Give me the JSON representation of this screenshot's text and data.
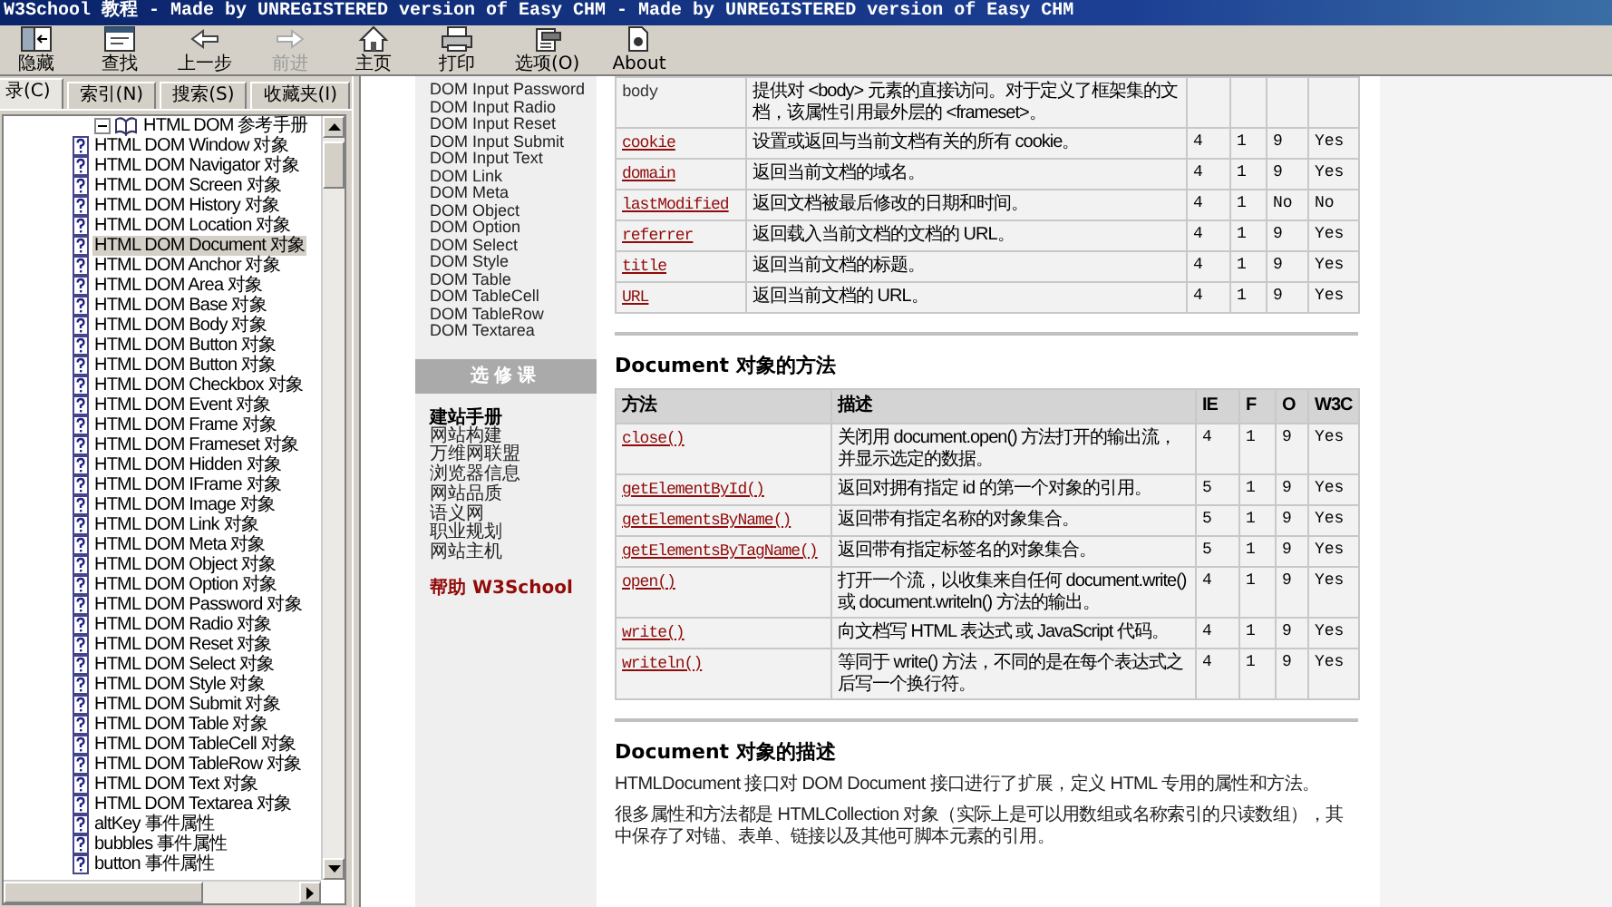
{
  "window": {
    "title": "W3School 教程 - Made by UNREGISTERED version of Easy CHM - Made by UNREGISTERED version of Easy CHM"
  },
  "toolbar": [
    {
      "kind": "hide",
      "label": "隐藏",
      "disabled": false
    },
    {
      "kind": "find",
      "label": "查找",
      "disabled": false
    },
    {
      "kind": "back",
      "label": "上一步",
      "disabled": false
    },
    {
      "kind": "forward",
      "label": "前进",
      "disabled": true
    },
    {
      "kind": "home",
      "label": "主页",
      "disabled": false
    },
    {
      "kind": "print",
      "label": "打印",
      "disabled": false
    },
    {
      "kind": "options",
      "label": "选项(O)",
      "disabled": false
    },
    {
      "kind": "about",
      "label": "About",
      "disabled": false
    }
  ],
  "nav_tabs": [
    {
      "label": "录(C)",
      "selected": true
    },
    {
      "label": "索引(N)",
      "selected": false
    },
    {
      "label": "搜索(S)",
      "selected": false
    },
    {
      "label": "收藏夹(I)",
      "selected": false
    }
  ],
  "tree": {
    "label": "HTML DOM 参考手册",
    "expanded": true,
    "children": [
      {
        "label": "HTML DOM Window 对象",
        "selected": false
      },
      {
        "label": "HTML DOM Navigator 对象",
        "selected": false
      },
      {
        "label": "HTML DOM Screen 对象",
        "selected": false
      },
      {
        "label": "HTML DOM History 对象",
        "selected": false
      },
      {
        "label": "HTML DOM Location 对象",
        "selected": false
      },
      {
        "label": "HTML DOM Document 对象",
        "selected": true
      },
      {
        "label": "HTML DOM Anchor 对象",
        "selected": false
      },
      {
        "label": "HTML DOM Area 对象",
        "selected": false
      },
      {
        "label": "HTML DOM Base 对象",
        "selected": false
      },
      {
        "label": "HTML DOM Body 对象",
        "selected": false
      },
      {
        "label": "HTML DOM Button 对象",
        "selected": false
      },
      {
        "label": "HTML DOM Button 对象",
        "selected": false
      },
      {
        "label": "HTML DOM Checkbox 对象",
        "selected": false
      },
      {
        "label": "HTML DOM Event 对象",
        "selected": false
      },
      {
        "label": "HTML DOM Frame 对象",
        "selected": false
      },
      {
        "label": "HTML DOM Frameset 对象",
        "selected": false
      },
      {
        "label": "HTML DOM Hidden 对象",
        "selected": false
      },
      {
        "label": "HTML DOM IFrame 对象",
        "selected": false
      },
      {
        "label": "HTML DOM Image 对象",
        "selected": false
      },
      {
        "label": "HTML DOM Link 对象",
        "selected": false
      },
      {
        "label": "HTML DOM Meta 对象",
        "selected": false
      },
      {
        "label": "HTML DOM Object 对象",
        "selected": false
      },
      {
        "label": "HTML DOM Option 对象",
        "selected": false
      },
      {
        "label": "HTML DOM Password 对象",
        "selected": false
      },
      {
        "label": "HTML DOM Radio 对象",
        "selected": false
      },
      {
        "label": "HTML DOM Reset 对象",
        "selected": false
      },
      {
        "label": "HTML DOM Select 对象",
        "selected": false
      },
      {
        "label": "HTML DOM Style 对象",
        "selected": false
      },
      {
        "label": "HTML DOM Submit 对象",
        "selected": false
      },
      {
        "label": "HTML DOM Table 对象",
        "selected": false
      },
      {
        "label": "HTML DOM TableCell 对象",
        "selected": false
      },
      {
        "label": "HTML DOM TableRow 对象",
        "selected": false
      },
      {
        "label": "HTML DOM Text 对象",
        "selected": false
      },
      {
        "label": "HTML DOM Textarea 对象",
        "selected": false
      },
      {
        "label": "altKey 事件属性",
        "selected": false
      },
      {
        "label": "bubbles 事件属性",
        "selected": false
      },
      {
        "label": "button 事件属性",
        "selected": false
      }
    ]
  },
  "side_nav": {
    "links": [
      "DOM Input Password",
      "DOM Input Radio",
      "DOM Input Reset",
      "DOM Input Submit",
      "DOM Input Text",
      "DOM Link",
      "DOM Meta",
      "DOM Object",
      "DOM Option",
      "DOM Select",
      "DOM Style",
      "DOM Table",
      "DOM TableCell",
      "DOM TableRow",
      "DOM Textarea"
    ],
    "section_title": "选修课",
    "section_heading": "建站手册",
    "section_links": [
      "网站构建",
      "万维网联盟",
      "浏览器信息",
      "网站品质",
      "语义网",
      "职业规划",
      "网站主机"
    ],
    "help_link": "帮助 W3School"
  },
  "properties_table": {
    "rows": [
      {
        "name": "body",
        "link": false,
        "description": "提供对 <body> 元素的直接访问。对于定义了框架集的文档，该属性引用最外层的 <frameset>。",
        "ie": "",
        "f": "",
        "o": "",
        "w3c": ""
      },
      {
        "name": "cookie",
        "link": true,
        "description": "设置或返回与当前文档有关的所有 cookie。",
        "ie": "4",
        "f": "1",
        "o": "9",
        "w3c": "Yes"
      },
      {
        "name": "domain",
        "link": true,
        "description": "返回当前文档的域名。",
        "ie": "4",
        "f": "1",
        "o": "9",
        "w3c": "Yes"
      },
      {
        "name": "lastModified",
        "link": true,
        "description": "返回文档被最后修改的日期和时间。",
        "ie": "4",
        "f": "1",
        "o": "No",
        "w3c": "No"
      },
      {
        "name": "referrer",
        "link": true,
        "description": "返回载入当前文档的文档的 URL。",
        "ie": "4",
        "f": "1",
        "o": "9",
        "w3c": "Yes"
      },
      {
        "name": "title",
        "link": true,
        "description": "返回当前文档的标题。",
        "ie": "4",
        "f": "1",
        "o": "9",
        "w3c": "Yes"
      },
      {
        "name": "URL",
        "link": true,
        "description": "返回当前文档的 URL。",
        "ie": "4",
        "f": "1",
        "o": "9",
        "w3c": "Yes"
      }
    ]
  },
  "methods_section": {
    "heading": "Document 对象的方法",
    "columns": [
      "方法",
      "描述",
      "IE",
      "F",
      "O",
      "W3C"
    ],
    "rows": [
      {
        "name": "close()",
        "link": true,
        "description": "关闭用 document.open() 方法打开的输出流，并显示选定的数据。",
        "ie": "4",
        "f": "1",
        "o": "9",
        "w3c": "Yes"
      },
      {
        "name": "getElementById()",
        "link": true,
        "description": "返回对拥有指定 id 的第一个对象的引用。",
        "ie": "5",
        "f": "1",
        "o": "9",
        "w3c": "Yes"
      },
      {
        "name": "getElementsByName()",
        "link": true,
        "description": "返回带有指定名称的对象集合。",
        "ie": "5",
        "f": "1",
        "o": "9",
        "w3c": "Yes"
      },
      {
        "name": "getElementsByTagName()",
        "link": true,
        "description": "返回带有指定标签名的对象集合。",
        "ie": "5",
        "f": "1",
        "o": "9",
        "w3c": "Yes"
      },
      {
        "name": "open()",
        "link": true,
        "description": "打开一个流，以收集来自任何 document.write() 或 document.writeln() 方法的输出。",
        "ie": "4",
        "f": "1",
        "o": "9",
        "w3c": "Yes"
      },
      {
        "name": "write()",
        "link": true,
        "description": "向文档写 HTML 表达式 或 JavaScript 代码。",
        "ie": "4",
        "f": "1",
        "o": "9",
        "w3c": "Yes"
      },
      {
        "name": "writeln()",
        "link": true,
        "description": "等同于 write() 方法，不同的是在每个表达式之后写一个换行符。",
        "ie": "4",
        "f": "1",
        "o": "9",
        "w3c": "Yes"
      }
    ]
  },
  "description_section": {
    "heading": "Document 对象的描述",
    "paragraphs": [
      "HTMLDocument 接口对 DOM Document 接口进行了扩展，定义 HTML 专用的属性和方法。",
      "很多属性和方法都是 HTMLCollection 对象（实际上是可以用数组或名称索引的只读数组），其中保存了对锚、表单、链接以及其他可脚本元素的引用。"
    ]
  }
}
